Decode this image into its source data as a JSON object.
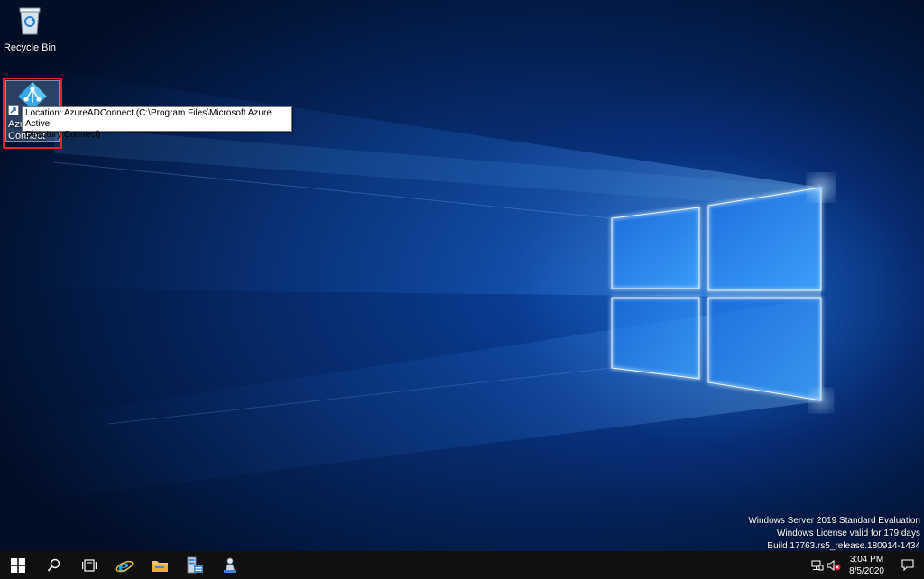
{
  "desktop": {
    "recycle_bin": {
      "label": "Recycle Bin"
    },
    "shortcut": {
      "label_line1": "Azu",
      "label_line2": "Connect"
    },
    "tooltip": {
      "text": "Location: AzureADConnect (C:\\Program Files\\Microsoft Azure Active\nDirectory Connect)"
    }
  },
  "watermark": {
    "line1": "Windows Server 2019 Standard Evaluation",
    "line2": "Windows License valid for 179 days",
    "line3": "Build 17763.rs5_release.180914-1434"
  },
  "taskbar": {
    "pinned": [
      "start-icon",
      "search-icon",
      "task-view-icon",
      "internet-explorer-icon",
      "file-explorer-icon",
      "server-manager-icon",
      "azure-ad-connect-icon"
    ],
    "tray_icons": [
      "network-icon",
      "volume-muted-icon",
      "notification-icon"
    ],
    "clock": {
      "time": "3:04 PM",
      "date": "8/5/2020"
    }
  },
  "colors": {
    "accent": "#0078d7",
    "selection_highlight": "#e8202a",
    "taskbar": "#101010"
  }
}
